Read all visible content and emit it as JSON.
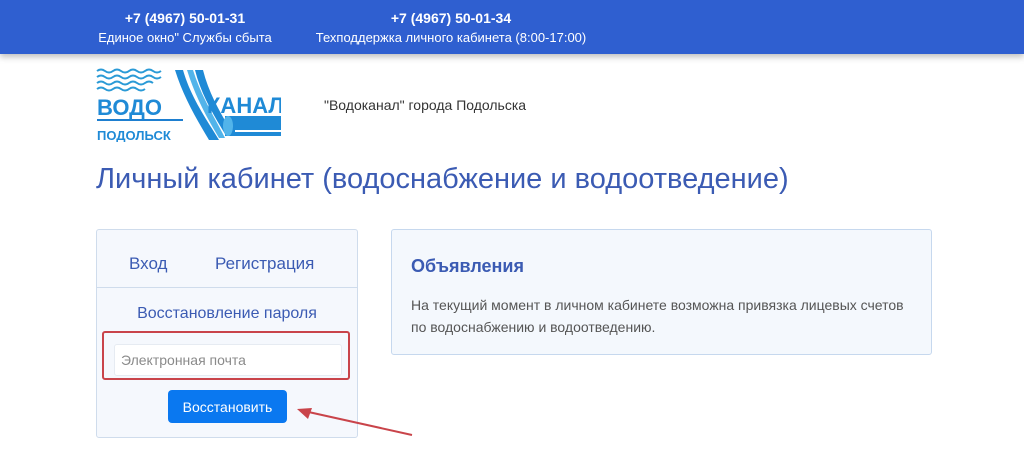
{
  "header": {
    "contacts": [
      {
        "phone": "+7 (4967) 50-01-31",
        "description": "Единое окно\" Службы сбыта"
      },
      {
        "phone": "+7 (4967) 50-01-34",
        "description": "Техподдержка личного кабинета (8:00-17:00)"
      }
    ]
  },
  "brand": {
    "logo_word_left": "ВОДО",
    "logo_word_right": "КАНАЛ",
    "logo_city": "ПОДОЛЬСК",
    "caption": "\"Водоканал\" города Подольска"
  },
  "page_title": "Личный кабинет (водоснабжение и водоотведение)",
  "auth": {
    "tabs": [
      {
        "label": "Вход"
      },
      {
        "label": "Регистрация"
      }
    ],
    "restore_title": "Восстановление пароля",
    "email_placeholder": "Электронная почта",
    "email_value": "",
    "restore_button": "Восстановить"
  },
  "announcements": {
    "title": "Объявления",
    "text": "На текущий момент в личном кабинете возможна привязка лицевых счетов по водоснабжению и водоотведению."
  },
  "colors": {
    "topbar": "#2f5fd0",
    "accent_text": "#3b5bb3",
    "primary_button": "#0a78f0",
    "highlight": "#c9444a"
  }
}
